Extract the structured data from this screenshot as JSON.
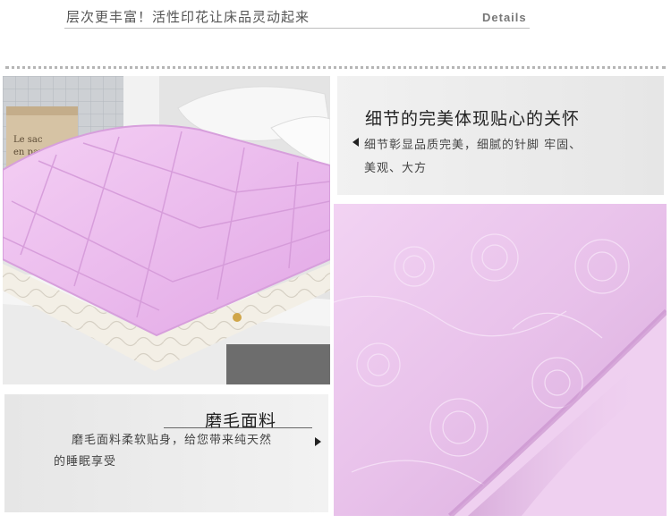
{
  "header": {
    "title": "层次更丰富！活性印花让床品灵动起来",
    "details_label": "Details"
  },
  "mattress_photo": {
    "box_label_line1": "Le sac",
    "box_label_line2": "en papier"
  },
  "detail_panel": {
    "heading": "细节的完美体现贴心的关怀",
    "body_line1": "细节彰显品质完美，细腻的针脚 牢固、",
    "body_line2": "美观、大方"
  },
  "brushed_panel": {
    "heading": "磨毛面料",
    "body_line1": "磨毛面料柔软贴身，给您带来纯天然",
    "body_line2": "的睡眠享受"
  },
  "colors": {
    "pink": "#eec5ee",
    "panel_gray": "#ececec",
    "text_dark": "#222222"
  }
}
